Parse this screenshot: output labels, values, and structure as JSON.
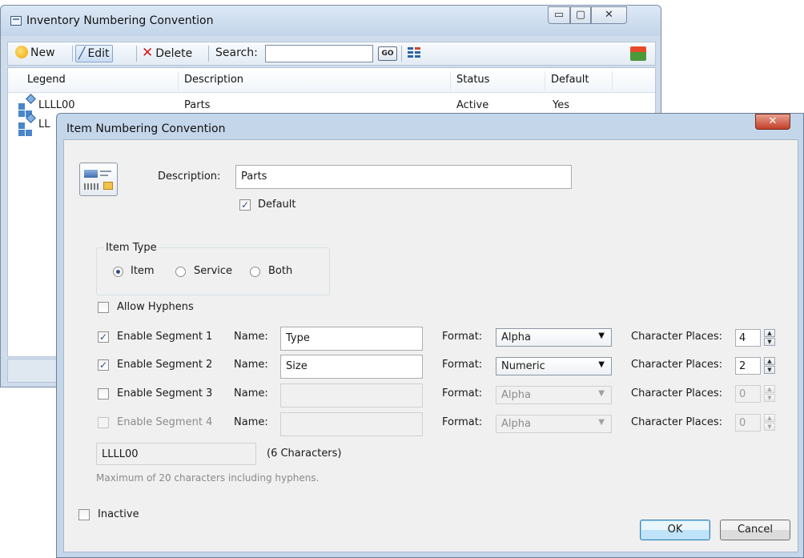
{
  "bg_window": {
    "title": "Inventory Numbering Convention",
    "controls": {
      "minimize": "▭",
      "maximize": "▢",
      "close": "✕"
    },
    "toolbar": {
      "new_label": "New",
      "edit_label": "Edit",
      "delete_label": "Delete",
      "search_label": "Search:",
      "search_value": "",
      "go_label": "GO"
    },
    "grid": {
      "headers": {
        "legend": "Legend",
        "description": "Description",
        "status": "Status",
        "default": "Default"
      },
      "rows": [
        {
          "legend": "LLLL00",
          "description": "Parts",
          "status": "Active",
          "default": "Yes"
        },
        {
          "legend": "LL",
          "description": "",
          "status": "",
          "default": ""
        }
      ]
    }
  },
  "dialog": {
    "title": "Item Numbering Convention",
    "close_glyph": "✕",
    "description_label": "Description:",
    "description_value": "Parts",
    "default_label": "Default",
    "default_checked": true,
    "item_type": {
      "legend": "Item Type",
      "options": [
        "Item",
        "Service",
        "Both"
      ],
      "selected": "Item"
    },
    "allow_hyphens_label": "Allow Hyphens",
    "name_label": "Name:",
    "format_label": "Format:",
    "char_places_label": "Character Places:",
    "segments": [
      {
        "label": "Enable Segment 1",
        "enabled": true,
        "name": "Type",
        "format": "Alpha",
        "places": "4"
      },
      {
        "label": "Enable Segment 2",
        "enabled": true,
        "name": "Size",
        "format": "Numeric",
        "places": "2"
      },
      {
        "label": "Enable Segment 3",
        "enabled": false,
        "name": "",
        "format": "Alpha",
        "places": "0"
      },
      {
        "label": "Enable Segment 4",
        "enabled": false,
        "name": "",
        "format": "Alpha",
        "places": "0"
      }
    ],
    "preview_value": "LLLL00",
    "preview_count": "(6 Characters)",
    "max_note": "Maximum of 20 characters including hyphens.",
    "inactive_label": "Inactive",
    "ok_label": "OK",
    "cancel_label": "Cancel"
  }
}
